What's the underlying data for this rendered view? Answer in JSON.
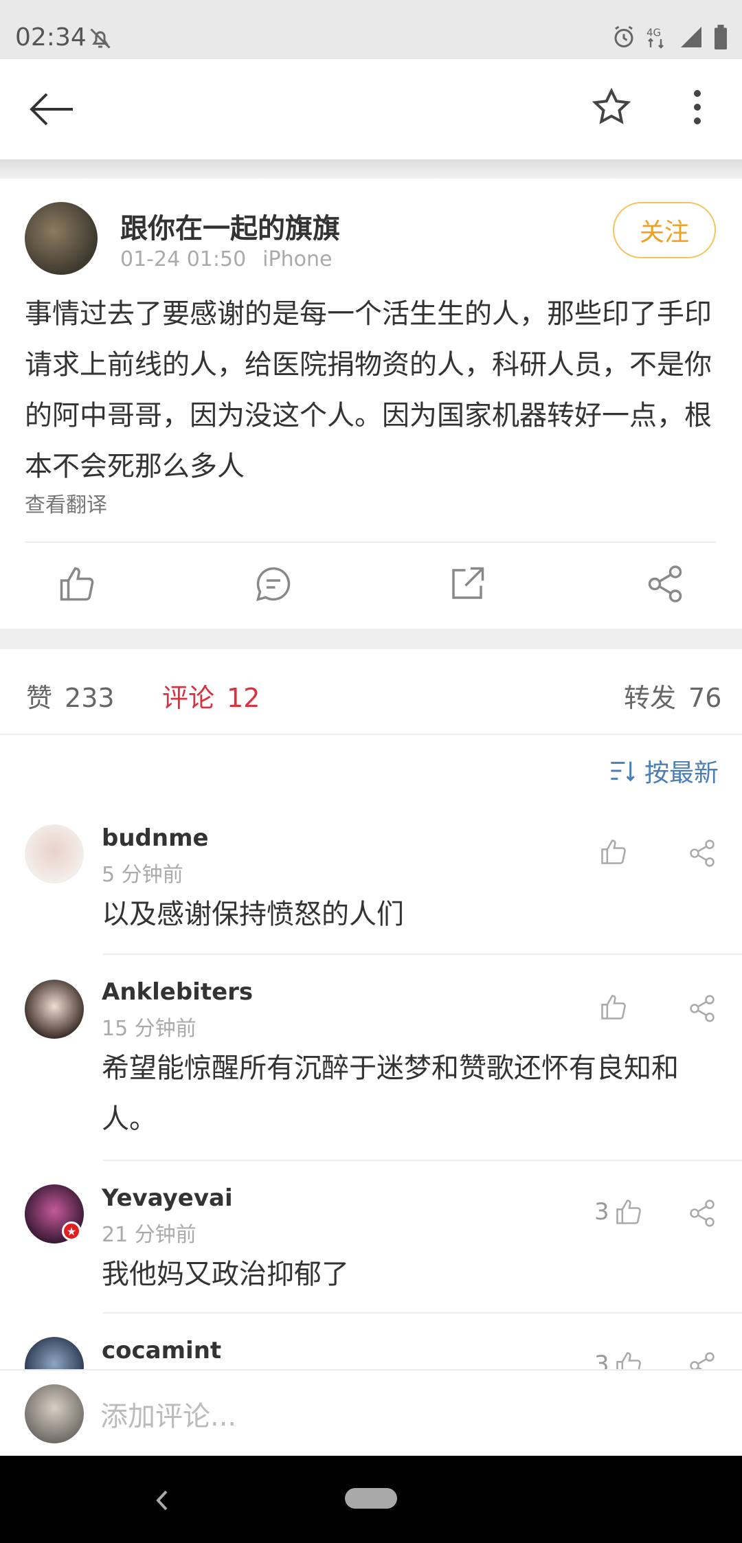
{
  "status_bar": {
    "time": "02:34"
  },
  "post": {
    "author": "跟你在一起的旗旗",
    "date": "01-24 01:50",
    "device": "iPhone",
    "follow_label": "关注",
    "content": "事情过去了要感谢的是每一个活生生的人，那些印了手印请求上前线的人，给医院捐物资的人，科研人员，不是你的阿中哥哥，因为没这个人。因为国家机器转好一点，根本不会死那么多人",
    "translate_label": "查看翻译"
  },
  "stats": {
    "likes_label": "赞",
    "likes_count": "233",
    "comments_label": "评论",
    "comments_count": "12",
    "reposts_label": "转发",
    "reposts_count": "76"
  },
  "sort_label": "按最新",
  "comments": [
    {
      "name": "budnme",
      "time": "5 分钟前",
      "text": "以及感谢保持愤怒的人们",
      "likes": ""
    },
    {
      "name": "Anklebiters",
      "time": "15 分钟前",
      "text": "希望能惊醒所有沉醉于迷梦和赞歌还怀有良知和人。",
      "likes": ""
    },
    {
      "name": "Yevayevai",
      "time": "21 分钟前",
      "text": "我他妈又政治抑郁了",
      "likes": "3"
    },
    {
      "name": "cocamint",
      "time": "",
      "text": "",
      "likes": "3"
    }
  ],
  "composer": {
    "placeholder": "添加评论..."
  },
  "colors": {
    "accent_red": "#d8323f",
    "follow_orange": "#f0a020",
    "link_blue": "#4a7fb5"
  }
}
